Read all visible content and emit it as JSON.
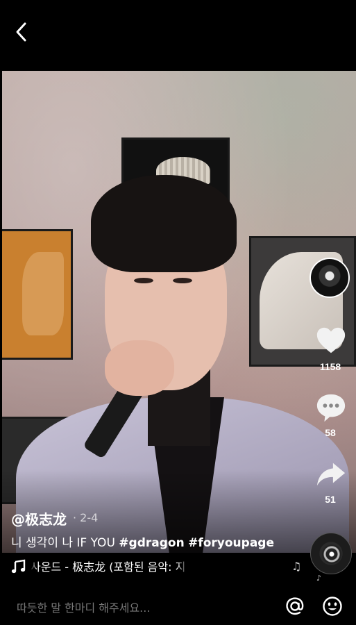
{
  "header": {
    "back_icon": "chevron-left-icon"
  },
  "video": {
    "description": ""
  },
  "actions": {
    "like_count": "1158",
    "comment_count": "58",
    "share_count": "51"
  },
  "post": {
    "username": "@极志龙",
    "date": "· 2-4",
    "caption_text": "니 생각이 나  IF YOU ",
    "hashtags": [
      "#gdragon",
      "#foryoupage"
    ]
  },
  "music": {
    "icon": "music-note-icon",
    "text": "사운드 - 极志龙 (포함된 음악: 지"
  },
  "comment": {
    "placeholder": "따듯한 말 한마디 해주세요..."
  },
  "colors": {
    "background": "#000000",
    "text": "#ffffff",
    "placeholder": "#777777"
  }
}
